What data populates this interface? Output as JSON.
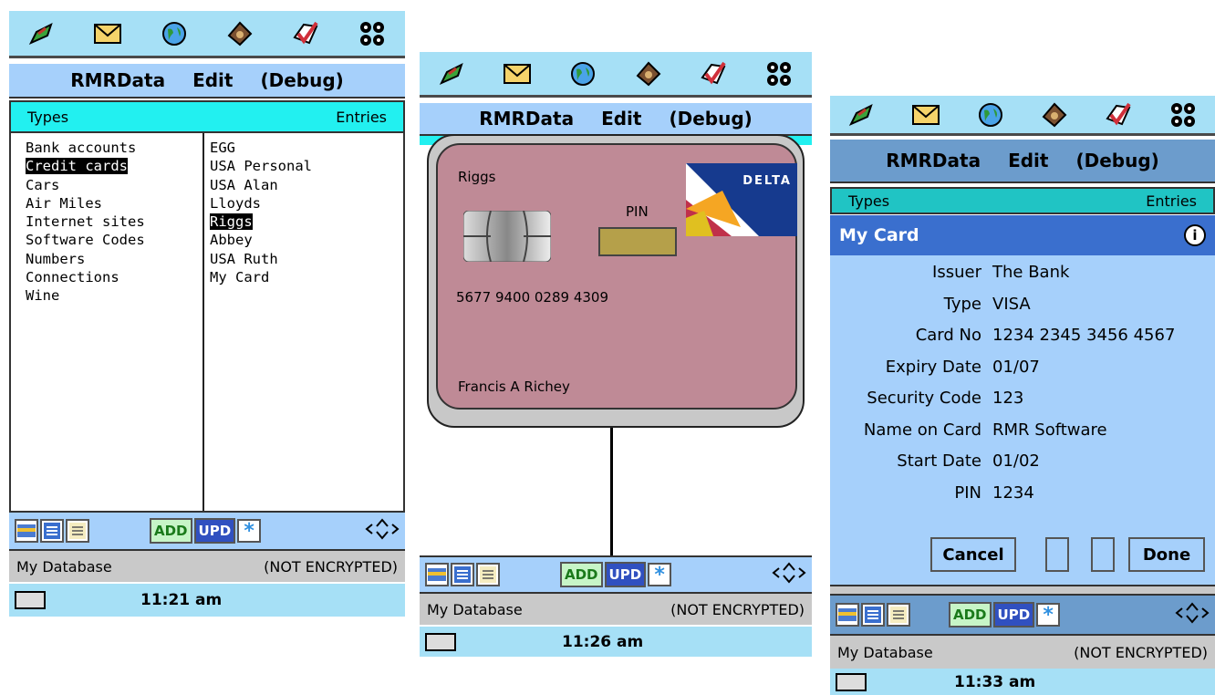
{
  "menu": {
    "app": "RMRData",
    "edit": "Edit",
    "debug": "(Debug)"
  },
  "tabs": {
    "types": "Types",
    "entries": "Entries"
  },
  "icons": [
    "pen-icon",
    "mail-icon",
    "globe-icon",
    "wallet-icon",
    "tick-icon",
    "grid-icon"
  ],
  "types": [
    "Bank accounts",
    "Credit cards",
    "Cars",
    "Air Miles",
    "Internet sites",
    "Software Codes",
    "Numbers",
    "Connections",
    "Wine"
  ],
  "entries": [
    "EGG",
    "USA Personal",
    "USA Alan",
    "Lloyds",
    "Riggs",
    "Abbey",
    "USA Ruth",
    "My Card"
  ],
  "selected_type": "Credit cards",
  "selected_entry": "Riggs",
  "toolbar": {
    "add": "ADD",
    "upd": "UPD"
  },
  "status": {
    "db": "My Database",
    "enc": "(NOT ENCRYPTED)"
  },
  "clock": {
    "s1": "11:21 am",
    "s2": "11:26 am",
    "s3": "11:33 am"
  },
  "card": {
    "bank": "Riggs",
    "pin_label": "PIN",
    "number": "5677 9400 0289 4309",
    "holder": "Francis A Richey",
    "brand": "DELTA"
  },
  "detail": {
    "title": "My Card",
    "fields": [
      {
        "k": "Issuer",
        "v": "The Bank"
      },
      {
        "k": "Type",
        "v": "VISA"
      },
      {
        "k": "Card No",
        "v": "1234 2345 3456 4567"
      },
      {
        "k": "Expiry Date",
        "v": "01/07"
      },
      {
        "k": "Security Code",
        "v": "123"
      },
      {
        "k": "Name on Card",
        "v": "RMR Software"
      },
      {
        "k": "Start Date",
        "v": "01/02"
      },
      {
        "k": "PIN",
        "v": "1234"
      }
    ],
    "cancel": "Cancel",
    "done": "Done"
  }
}
